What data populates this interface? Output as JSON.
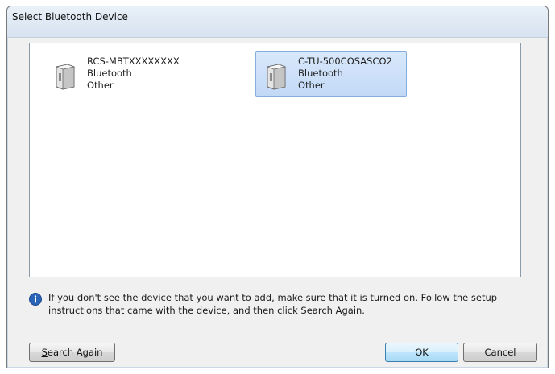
{
  "window": {
    "title": "Select Bluetooth Device"
  },
  "devices": [
    {
      "name": "RCS-MBTXXXXXXXX",
      "type": "Bluetooth",
      "category": "Other",
      "selected": false,
      "icon": "device-icon"
    },
    {
      "name": "C-TU-500COSASCO2",
      "type": "Bluetooth",
      "category": "Other",
      "selected": true,
      "icon": "device-icon"
    }
  ],
  "info": {
    "icon": "info-icon",
    "text": "If you don't see the device that you want to add, make sure that it is turned on. Follow the setup instructions that came with the device, and then click Search Again."
  },
  "buttons": {
    "search_again_accel": "S",
    "search_again_rest": "earch Again",
    "ok": "OK",
    "cancel": "Cancel"
  }
}
